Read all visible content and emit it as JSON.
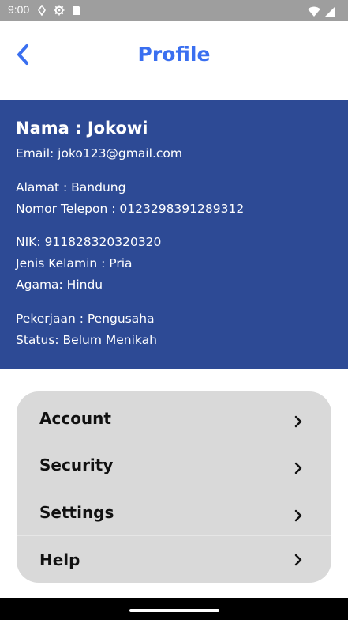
{
  "status_bar": {
    "time": "9:00",
    "left_icons": [
      "signal-diamond-icon",
      "gear-icon",
      "sim-card-icon"
    ],
    "right_icons": [
      "wifi-icon",
      "cell-signal-icon"
    ]
  },
  "header": {
    "title": "Profile",
    "back_icon": "chevron-left-icon",
    "accent_color": "#3a6ff0"
  },
  "profile": {
    "name": "Nama : Jokowi",
    "email": "Email: joko123@gmail.com",
    "address": "Alamat : Bandung",
    "phone": "Nomor Telepon : 0123298391289312",
    "nik": "NIK: 911828320320320",
    "gender": "Jenis Kelamin : Pria",
    "religion": "Agama: Hindu",
    "occupation": "Pekerjaan : Pengusaha",
    "status": "Status: Belum Menikah",
    "panel_color": "#2d4a95"
  },
  "menu": {
    "items": [
      {
        "label": "Account",
        "icon": "chevron-right-icon"
      },
      {
        "label": "Security",
        "icon": "chevron-right-icon"
      },
      {
        "label": "Settings",
        "icon": "chevron-right-icon"
      },
      {
        "label": "Help",
        "icon": "chevron-right-icon"
      }
    ]
  }
}
